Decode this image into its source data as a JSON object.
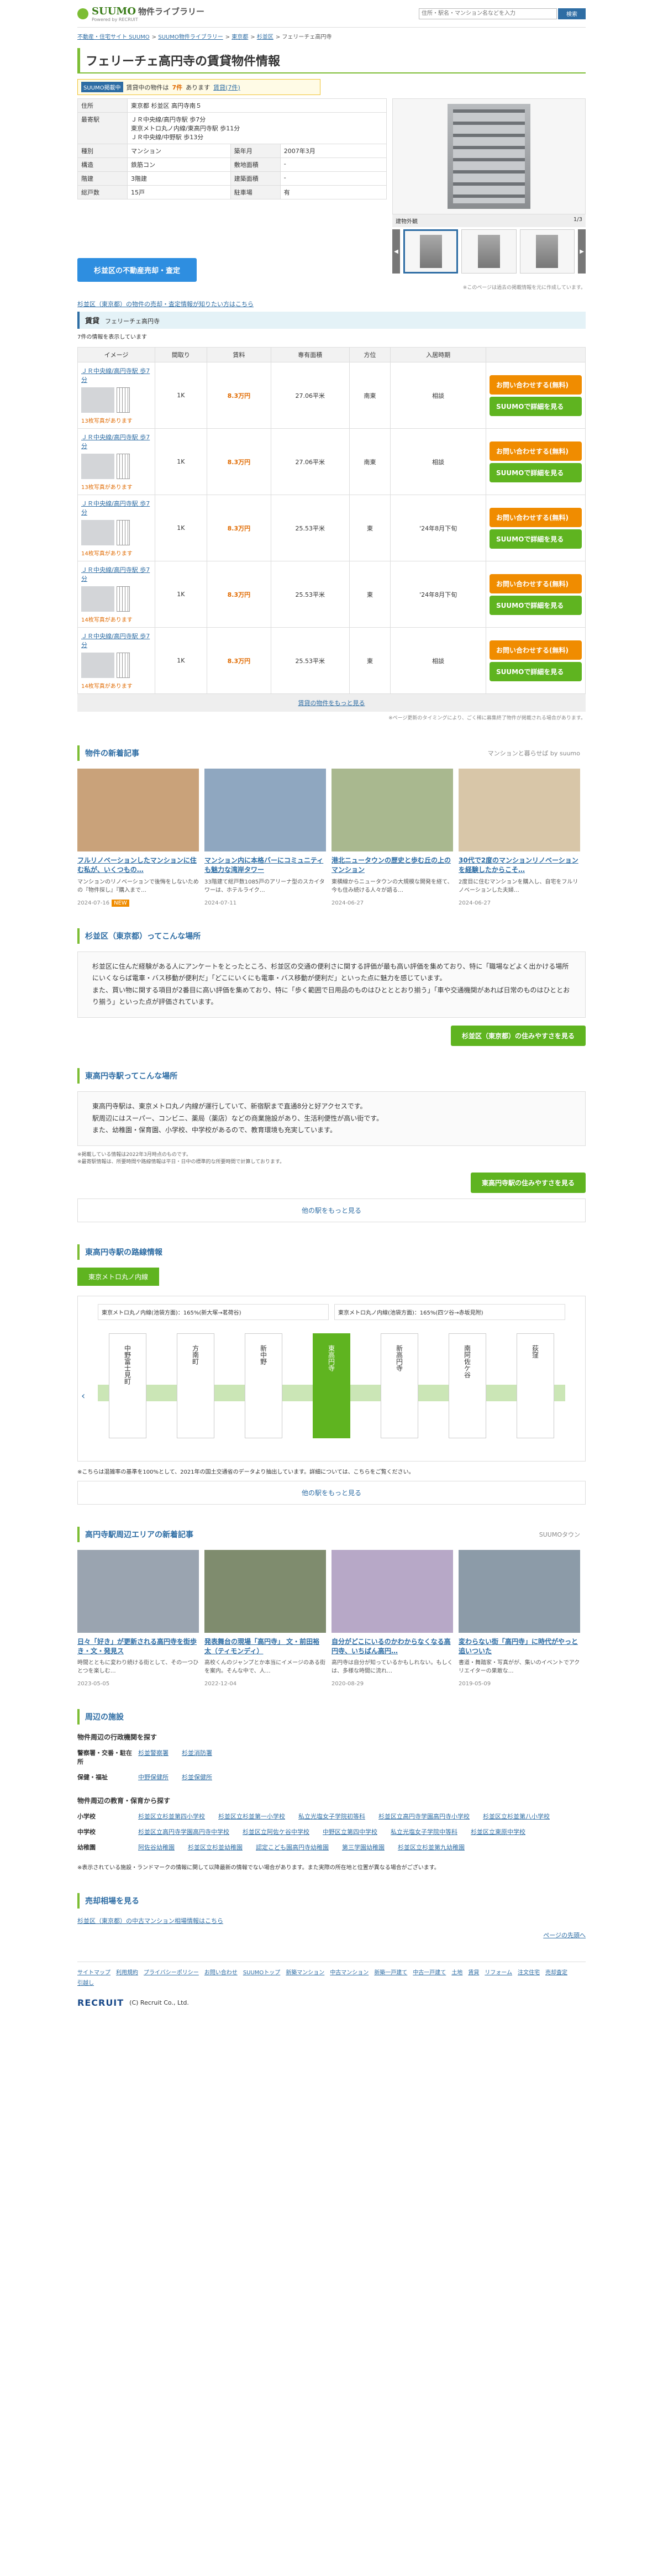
{
  "header": {
    "logo_brand": "SUUMO",
    "logo_title": "物件ライブラリー",
    "logo_sub": "Powered by RECRUIT",
    "search_placeholder": "住所・駅名・マンション名などを入力",
    "search_button": "検索"
  },
  "breadcrumb": [
    "不動産・住宅サイト SUUMO",
    "SUUMO物件ライブラリー",
    "東京都",
    "杉並区",
    "フェリーチェ高円寺"
  ],
  "title": "フェリーチェ高円寺の賃貸物件情報",
  "suumo_badge": {
    "label": "SUUMO掲載中",
    "text": "賃貸中の物件は",
    "count": "7件",
    "rest": "あります",
    "link": "賃貸(7件)"
  },
  "info": [
    {
      "h": "住所",
      "v": "東京都 杉並区 高円寺南５"
    },
    {
      "h": "最寄駅",
      "v": "ＪＲ中央線/高円寺駅 歩7分\n東京メトロ丸ノ内線/東高円寺駅 歩11分\nＪＲ中央線/中野駅 歩13分"
    },
    {
      "h": "種別",
      "v": "マンション",
      "h2": "築年月",
      "v2": "2007年3月"
    },
    {
      "h": "構造",
      "v": "鉄筋コン",
      "h2": "敷地面積",
      "v2": "-"
    },
    {
      "h": "階建",
      "v": "3階建",
      "h2": "建築面積",
      "v2": "-"
    },
    {
      "h": "総戸数",
      "v": "15戸",
      "h2": "駐車場",
      "v2": "有"
    }
  ],
  "photo": {
    "caption": "建物外観",
    "count": "1/3",
    "note": "※このページは過去の掲載情報を元に作成しています。"
  },
  "appraisal_button": "杉並区の不動産売却・査定",
  "kairyo_link": "杉並区（東京都）の物件の売却・査定情報が知りたい方はこちら",
  "rent": {
    "section": "賃貸",
    "name": "フェリーチェ高円寺",
    "count_text": "7件の情報を表示しています",
    "headers": [
      "イメージ",
      "間取り",
      "賃料",
      "専有面積",
      "方位",
      "入居時期",
      ""
    ],
    "rows": [
      {
        "station": "ＪＲ中央線/高円寺駅 歩7分",
        "badge": "13枚写真があります",
        "madori": "1K",
        "price": "8.3万円",
        "area": "27.06平米",
        "dir": "南東",
        "move": "相談",
        "btn1": "お問い合わせする(無料)",
        "btn2": "SUUMOで詳細を見る"
      },
      {
        "station": "ＪＲ中央線/高円寺駅 歩7分",
        "badge": "13枚写真があります",
        "madori": "1K",
        "price": "8.3万円",
        "area": "27.06平米",
        "dir": "南東",
        "move": "相談",
        "btn1": "お問い合わせする(無料)",
        "btn2": "SUUMOで詳細を見る"
      },
      {
        "station": "ＪＲ中央線/高円寺駅 歩7分",
        "badge": "14枚写真があります",
        "madori": "1K",
        "price": "8.3万円",
        "area": "25.53平米",
        "dir": "東",
        "move": "'24年8月下旬",
        "btn1": "お問い合わせする(無料)",
        "btn2": "SUUMOで詳細を見る"
      },
      {
        "station": "ＪＲ中央線/高円寺駅 歩7分",
        "badge": "14枚写真があります",
        "madori": "1K",
        "price": "8.3万円",
        "area": "25.53平米",
        "dir": "東",
        "move": "'24年8月下旬",
        "btn1": "お問い合わせする(無料)",
        "btn2": "SUUMOで詳細を見る"
      },
      {
        "station": "ＪＲ中央線/高円寺駅 歩7分",
        "badge": "14枚写真があります",
        "madori": "1K",
        "price": "8.3万円",
        "area": "25.53平米",
        "dir": "東",
        "move": "相談",
        "btn1": "お問い合わせする(無料)",
        "btn2": "SUUMOで詳細を見る"
      }
    ],
    "more": "賃貸の物件をもっと見る",
    "note": "※ページ更新のタイミングにより、ごく稀に募集終了物件が掲載される場合があります。"
  },
  "articles": {
    "title": "物件の新着記事",
    "side": "マンションと暮らせば by suumo",
    "items": [
      {
        "title": "フルリノベーションしたマンションに住む私が、いくつもの…",
        "desc": "マンションのリノベーションで後悔をしないための『物件探し』『購入まで…",
        "date": "2024-07-16",
        "new": "NEW"
      },
      {
        "title": "マンション内に本格バーにコミュニティも魅力な湾岸タワー",
        "desc": "33階建て総戸数1085戸のアリーナ型のスカイタワーは、ホテルライク…",
        "date": "2024-07-11"
      },
      {
        "title": "港北ニュータウンの歴史と歩む丘の上のマンション",
        "desc": "東横線からニュータウンの大規模な開発を経て、今も住み続ける人々が語る…",
        "date": "2024-06-27"
      },
      {
        "title": "30代で2度のマンションリノベーションを経験したからこそ…",
        "desc": "2度目に住むマンションを購入し、自宅をフルリノベーションした夫婦…",
        "date": "2024-06-27"
      }
    ]
  },
  "area": {
    "title": "杉並区（東京都）ってこんな場所",
    "text": "杉並区に住んだ経験がある人にアンケートをとったところ、杉並区の交通の便利さに関する評価が最も高い評価を集めており、特に「職場などよく出かける場所にいくならば電車・バス移動が便利だ」「どこにいくにも電車・バス移動が便利だ」といった点に魅力を感じています。\nまた、買い物に関する項目が2番目に高い評価を集めており、特に「歩く範囲で日用品のものはひとととおり揃う」「車や交通機関があれば日常のものはひととおり揃う」といった点が評価されています。",
    "button": "杉並区（東京都）の住みやすさを見る"
  },
  "station": {
    "title": "東高円寺駅ってこんな場所",
    "text": "東高円寺駅は、東京メトロ丸ノ内線が運行していて、新宿駅まで直通8分と好アクセスです。\n駅周辺にはスーパー、コンビニ、薬局（薬店）などの商業施設があり、生活利便性が高い街です。\nまた、幼稚園・保育園、小学校、中学校があるので、教育環境も充実しています。",
    "notes": "※掲載している情報は2022年3月時点のものです。\n※最寄駅情報は、所要時間や路線情報は平日・日中の標準的な所要時間で計算しております。",
    "button": "東高円寺駅の住みやすさを見る",
    "more": "他の駅をもっと見る"
  },
  "route": {
    "title": "東高円寺駅の路線情報",
    "tab": "東京メトロ丸ノ内線",
    "head1": "東京メトロ丸ノ内線(池袋方面)：165%(新大塚→茗荷谷)",
    "head2": "東京メトロ丸ノ内線(池袋方面)：165%(四ツ谷→赤坂見附)",
    "stations": [
      "中野富士見町",
      "方南町",
      "新中野",
      "東高円寺",
      "新高円寺",
      "南阿佐ケ谷",
      "荻窪"
    ],
    "current": "東高円寺",
    "note": "※こちらは混雑率の基準を100%として、2021年の国土交通省のデータより抽出しています。詳細については、こちらをご覧ください。",
    "more": "他の駅をもっと見る"
  },
  "news": {
    "title": "高円寺駅周辺エリアの新着記事",
    "side": "SUUMOタウン",
    "items": [
      {
        "title": "日々「好き」が更新される高円寺を街歩き・文・発見ス",
        "desc": "時間とともに変わり続ける街として、その一つひとつを楽しむ…",
        "date": "2023-05-05"
      },
      {
        "title": "発表舞台の現場「高円寺」 文・前田裕太（ティモンディ）",
        "desc": "高校くんのジャンプとか本当にイメージのある街を案内。そんな中で、人…",
        "date": "2022-12-04"
      },
      {
        "title": "自分がどこにいるのかわからなくなる高円寺、いちばん高円…",
        "desc": "高円寺は自分が知っているかもしれない。もしくは、多様な時間に流れ…",
        "date": "2020-08-29"
      },
      {
        "title": "変わらない街「高円寺」に時代がやっと追いついた",
        "desc": "書道・舞踏家・写真がが、集いのイベントでアクリエイターの果敢な…",
        "date": "2019-05-09"
      }
    ]
  },
  "facilities": {
    "title": "周辺の施設",
    "admin_title": "物件周辺の行政機関を探す",
    "admin": [
      {
        "g": "警察署・交番・駐在所",
        "items": [
          "杉並警察署",
          "杉並消防署"
        ]
      },
      {
        "g": "保健・福祉",
        "items": [
          "中野保健所",
          "杉並保健所"
        ]
      }
    ],
    "edu_title": "物件周辺の教育・保育から探す",
    "edu": [
      {
        "g": "小学校",
        "items": [
          "杉並区立杉並第四小学校",
          "杉並区立杉並第一小学校",
          "私立光塩女子学院初等科",
          "杉並区立高円寺学園高円寺小学校",
          "杉並区立杉並第八小学校"
        ]
      },
      {
        "g": "中学校",
        "items": [
          "杉並区立高円寺学園高円寺中学校",
          "杉並区立阿佐ケ谷中学校",
          "中野区立第四中学校",
          "私立光塩女子学院中等科",
          "杉並区立東原中学校"
        ]
      },
      {
        "g": "幼稚園",
        "items": [
          "阿佐谷幼稚園",
          "杉並区立杉並幼稚園",
          "認定こども園高円寺幼稚園",
          "第三学園幼稚園",
          "杉並区立杉並第九幼稚園"
        ]
      }
    ],
    "note": "※表示されている施設・ランドマークの情報に関して以降最新の情報でない場合があります。また実際の所在地と位置が異なる場合がございます。"
  },
  "selling": {
    "title": "売却相場を見る",
    "link": "杉並区（東京都）の中古マンション相場情報はこちら"
  },
  "footer": {
    "top": "ページの先頭へ",
    "links": [
      "サイトマップ",
      "利用規約",
      "プライバシーポリシー",
      "お問い合わせ",
      "SUUMOトップ",
      "新築マンション",
      "中古マンション",
      "新築一戸建て",
      "中古一戸建て",
      "土地",
      "賃貸",
      "リフォーム",
      "注文住宅",
      "売却査定",
      "引越し"
    ],
    "company": "RECRUIT",
    "copyright": "(C) Recruit Co., Ltd."
  }
}
